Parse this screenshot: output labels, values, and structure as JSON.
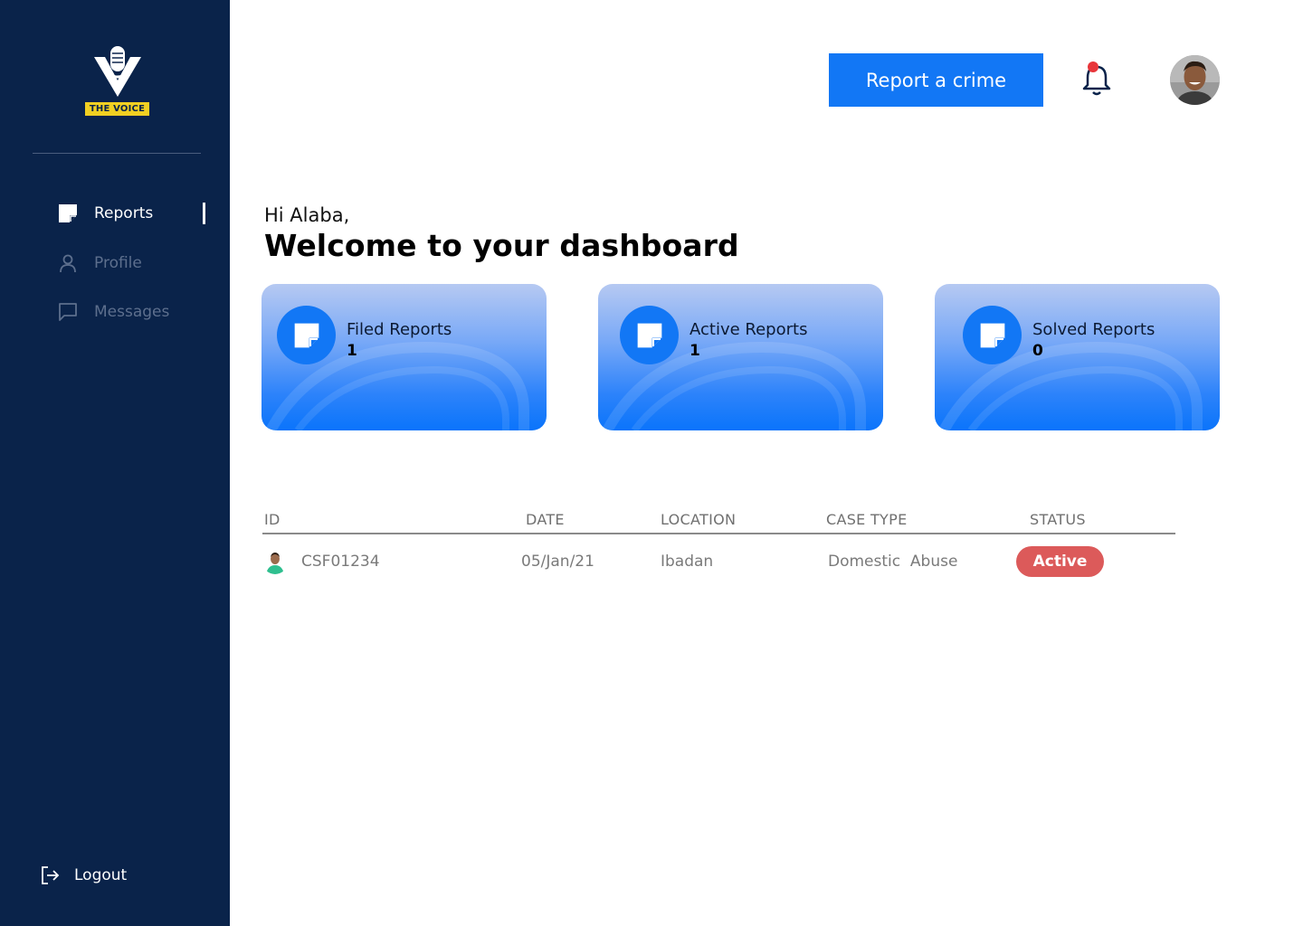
{
  "sidebar": {
    "logo_text": "THE VOICE",
    "items": [
      {
        "label": "Reports",
        "icon": "report-note-icon",
        "active": true
      },
      {
        "label": "Profile",
        "icon": "person-icon",
        "active": false
      },
      {
        "label": "Messages",
        "icon": "chat-bubble-icon",
        "active": false
      }
    ],
    "logout_label": "Logout"
  },
  "header": {
    "report_button": "Report a crime",
    "notification_dot_color": "#e8363b"
  },
  "main": {
    "greeting": "Hi Alaba,",
    "title": "Welcome to your dashboard",
    "cards": [
      {
        "label": "Filed Reports",
        "value": "1"
      },
      {
        "label": "Active Reports",
        "value": "1"
      },
      {
        "label": "Solved Reports",
        "value": "0"
      }
    ]
  },
  "table": {
    "headers": [
      "ID",
      "DATE",
      "LOCATION",
      "CASE TYPE",
      "STATUS"
    ],
    "rows": [
      {
        "id": "CSF01234",
        "date": "05/Jan/21",
        "location": "Ibadan",
        "case_type": "Domestic  Abuse",
        "status": "Active"
      }
    ]
  },
  "colors": {
    "sidebar_bg": "#0a234a",
    "accent": "#1277f5",
    "status_active": "#dc5a5a",
    "logo_badge": "#f2d022"
  }
}
